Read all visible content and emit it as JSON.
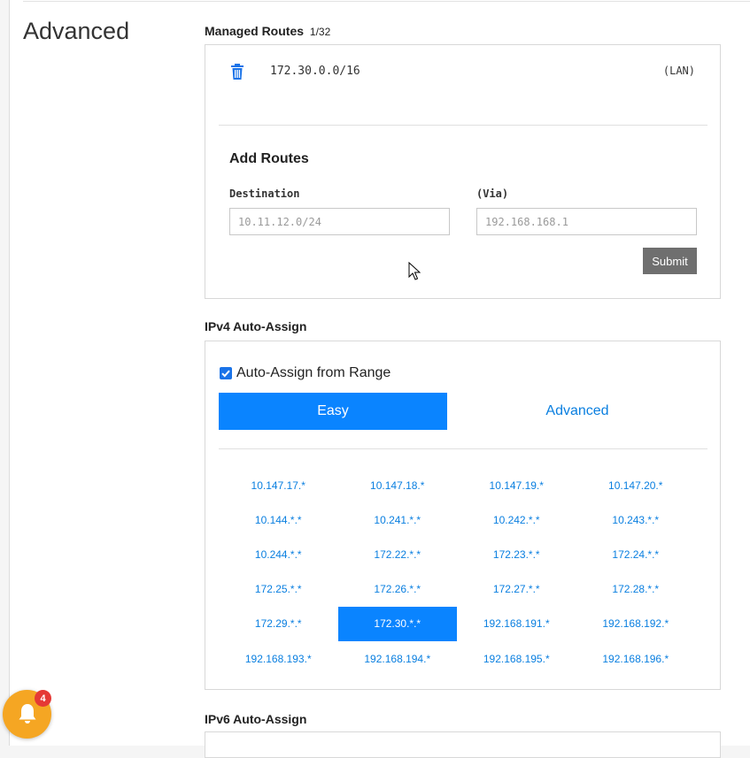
{
  "section": {
    "title": "Advanced"
  },
  "managed_routes": {
    "label": "Managed Routes",
    "count": "1/32",
    "routes": [
      {
        "address": "172.30.0.0/16",
        "tag": "(LAN)",
        "icon": "trash-icon"
      }
    ],
    "add_title": "Add Routes",
    "destination_label": "Destination",
    "destination_placeholder": "10.11.12.0/24",
    "via_label": "(Via)",
    "via_placeholder": "192.168.168.1",
    "submit_label": "Submit"
  },
  "ipv4": {
    "label": "IPv4 Auto-Assign",
    "checkbox_label": "Auto-Assign from Range",
    "checkbox_checked": true,
    "tabs": [
      {
        "label": "Easy",
        "active": true
      },
      {
        "label": "Advanced",
        "active": false
      }
    ],
    "ranges": [
      "10.147.17.*",
      "10.147.18.*",
      "10.147.19.*",
      "10.147.20.*",
      "10.144.*.*",
      "10.241.*.*",
      "10.242.*.*",
      "10.243.*.*",
      "10.244.*.*",
      "172.22.*.*",
      "172.23.*.*",
      "172.24.*.*",
      "172.25.*.*",
      "172.26.*.*",
      "172.27.*.*",
      "172.28.*.*",
      "172.29.*.*",
      "172.30.*.*",
      "192.168.191.*",
      "192.168.192.*",
      "192.168.193.*",
      "192.168.194.*",
      "192.168.195.*",
      "192.168.196.*"
    ],
    "selected_range": "172.30.*.*"
  },
  "ipv6": {
    "label": "IPv6 Auto-Assign"
  },
  "notifications": {
    "count": "4",
    "icon": "bell-icon"
  },
  "colors": {
    "accent": "#0a84ff",
    "link": "#0a7fe0",
    "submit": "#6f6f6f",
    "bell": "#f5a623",
    "badge": "#e53935"
  }
}
